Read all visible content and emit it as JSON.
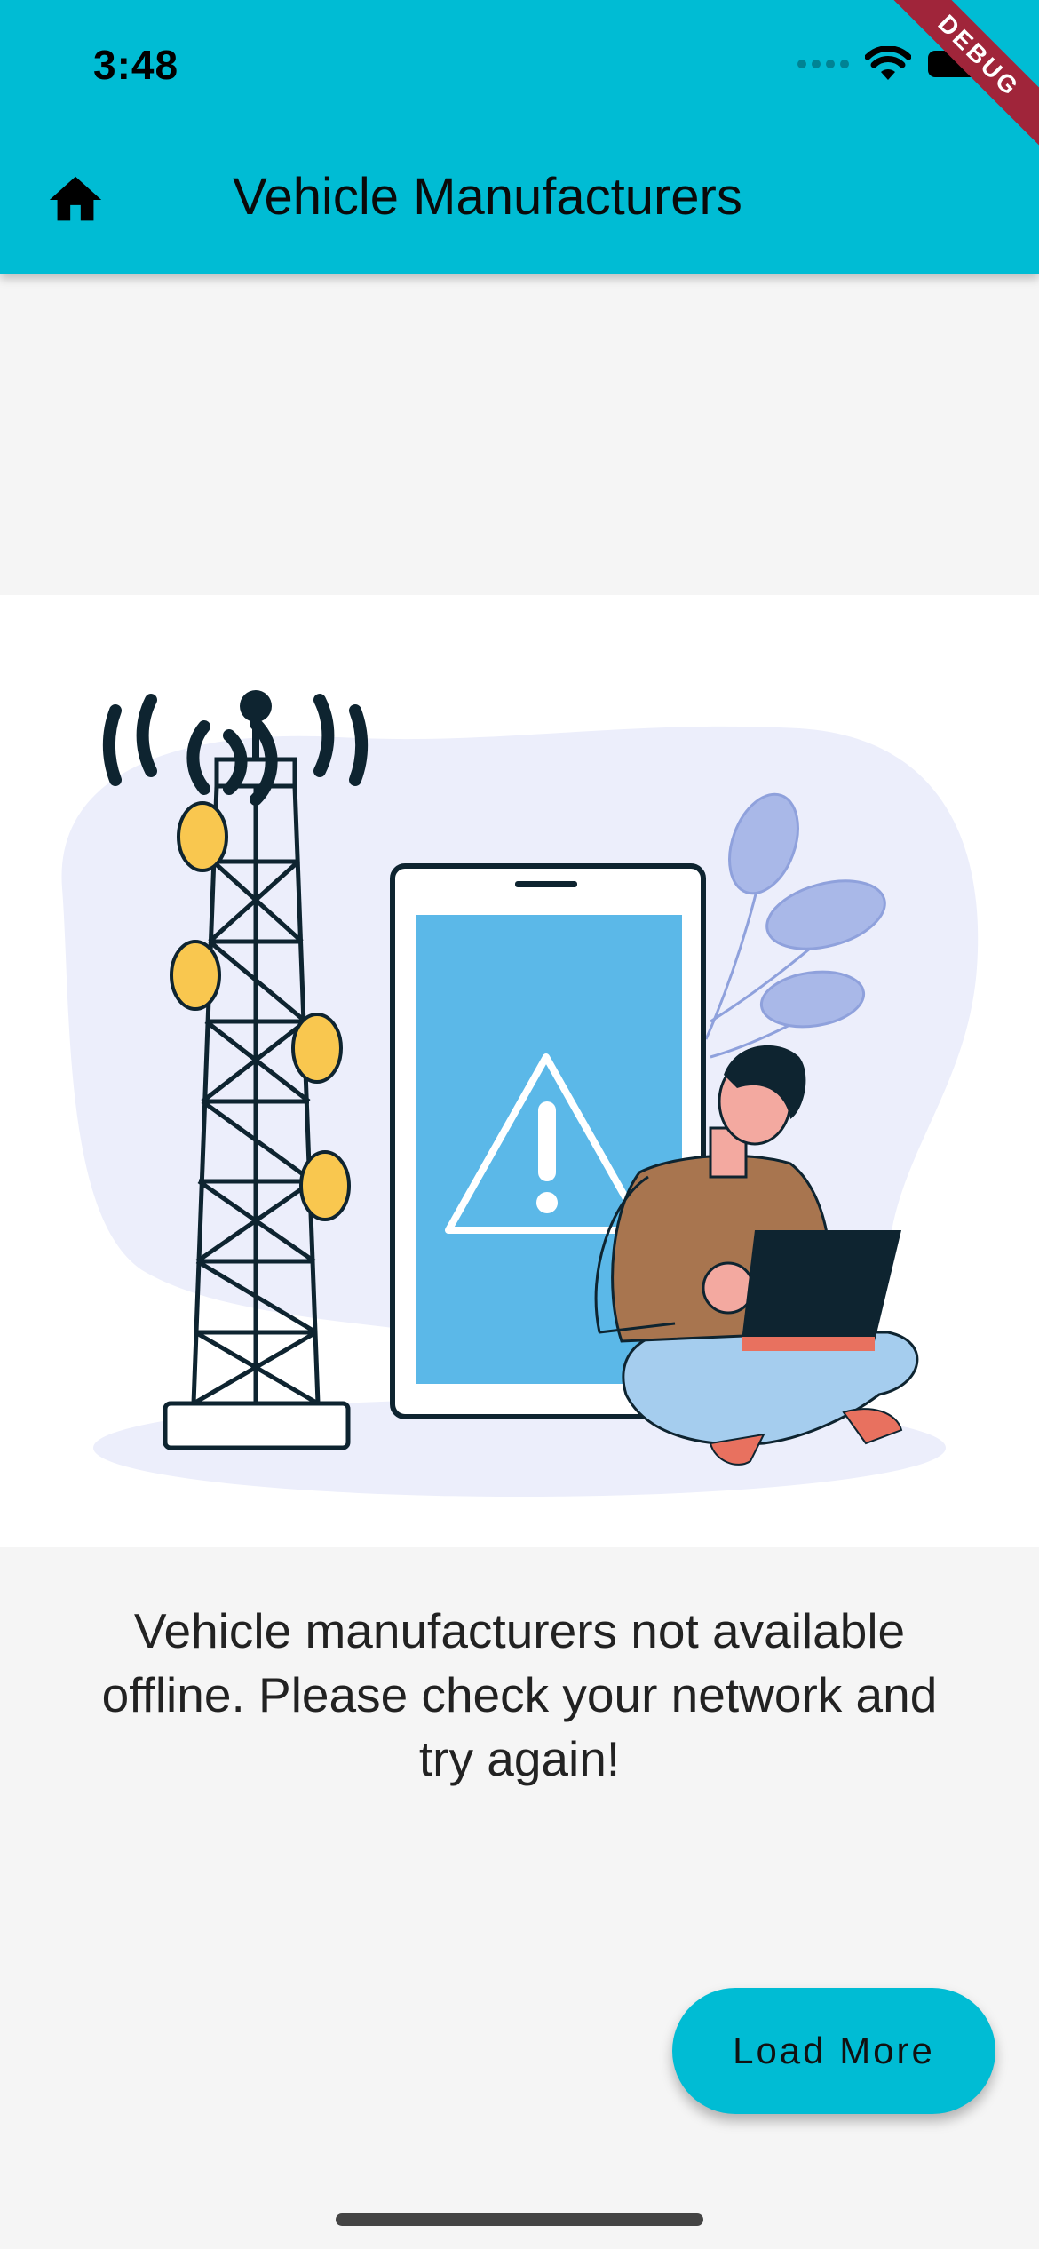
{
  "status_bar": {
    "time": "3:48"
  },
  "app_bar": {
    "title": "Vehicle Manufacturers",
    "home_icon": "home-icon",
    "color": "#00bcd4"
  },
  "debug_banner": {
    "label": "DEBUG"
  },
  "empty_state": {
    "illustration": "no-network-illustration",
    "message": "Vehicle manufacturers not available offline. Please check your network and try again!"
  },
  "fab": {
    "label": "Load More"
  }
}
